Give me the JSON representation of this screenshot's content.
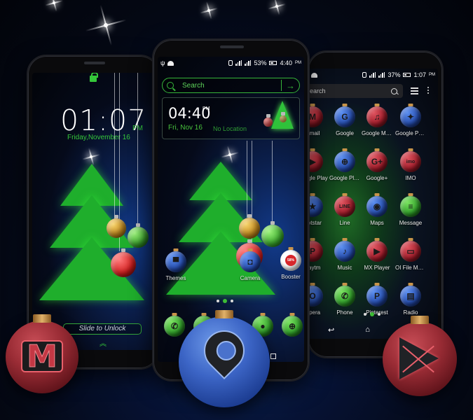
{
  "lock_screen": {
    "time": "01:07",
    "ampm": "PM",
    "date": "Friday,November 16",
    "slide_label": "Slide to Unlock"
  },
  "home_screen": {
    "status": {
      "battery": "53%",
      "time": "4:40",
      "ampm": "PM"
    },
    "search_placeholder": "Search",
    "clock_widget": {
      "time": "04:40",
      "ampm": "PM",
      "date": "Fri, Nov 16",
      "location": "No Location"
    },
    "apps": [
      {
        "label": "Themes",
        "icon": "tshirt-icon",
        "color": "blue"
      },
      {
        "label": "Camera",
        "icon": "camera-icon",
        "color": "blue"
      },
      {
        "label": "Booster",
        "icon": "booster-icon",
        "color": "white",
        "percent": "58%"
      }
    ],
    "dock": [
      {
        "name": "phone",
        "icon": "phone-icon"
      },
      {
        "name": "messages",
        "icon": "message-icon"
      },
      {
        "name": "maps",
        "icon": "map-pin-icon"
      },
      {
        "name": "contacts",
        "icon": "contact-icon"
      },
      {
        "name": "browser",
        "icon": "globe-icon"
      }
    ]
  },
  "drawer_screen": {
    "status": {
      "battery": "37%",
      "time": "1:07",
      "ampm": "PM"
    },
    "search_placeholder": "Search",
    "apps": [
      {
        "label": "Gmail",
        "color": "red",
        "glyph": "M"
      },
      {
        "label": "Google",
        "color": "blue",
        "glyph": "G"
      },
      {
        "label": "Google Music",
        "color": "red",
        "glyph": "♫"
      },
      {
        "label": "Google Phot...",
        "color": "blue",
        "glyph": "✦"
      },
      {
        "label": "Google Play",
        "color": "red",
        "glyph": "▶"
      },
      {
        "label": "Google Play...",
        "color": "blue",
        "glyph": "⊕"
      },
      {
        "label": "Google+",
        "color": "red",
        "glyph": "G+"
      },
      {
        "label": "IMO",
        "color": "red",
        "glyph": "imo"
      },
      {
        "label": "Hotstar",
        "color": "blue",
        "glyph": "★"
      },
      {
        "label": "Line",
        "color": "red",
        "glyph": "LINE"
      },
      {
        "label": "Maps",
        "color": "blue",
        "glyph": "◉"
      },
      {
        "label": "Message",
        "color": "green",
        "glyph": "≡"
      },
      {
        "label": "Paytm",
        "color": "red",
        "glyph": "P"
      },
      {
        "label": "Music",
        "color": "blue",
        "glyph": "♪"
      },
      {
        "label": "MX Player",
        "color": "red",
        "glyph": "▶"
      },
      {
        "label": "OI File Mana...",
        "color": "red",
        "glyph": "▭"
      },
      {
        "label": "Opera",
        "color": "blue",
        "glyph": "O"
      },
      {
        "label": "Phone",
        "color": "green",
        "glyph": "✆"
      },
      {
        "label": "Pinterest",
        "color": "blue",
        "glyph": "P"
      },
      {
        "label": "Radio",
        "color": "blue",
        "glyph": "▤"
      }
    ]
  },
  "featured_icons": [
    {
      "name": "gmail",
      "icon": "gmail-icon"
    },
    {
      "name": "maps",
      "icon": "map-pin-icon"
    },
    {
      "name": "google-play",
      "icon": "play-store-icon"
    }
  ]
}
